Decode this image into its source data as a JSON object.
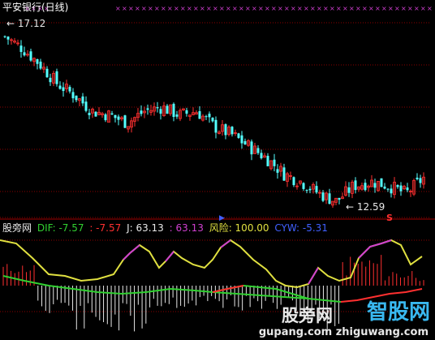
{
  "main_panel": {
    "title": "平安银行(日线)",
    "high_label": "17.12",
    "low_label": "12.59",
    "signal_marker": "S"
  },
  "indicator_panel": {
    "name": "股旁网",
    "items": [
      {
        "label": "DIF: -7.57",
        "color": "#30d030"
      },
      {
        "label": ": -7.57",
        "color": "#ff3030"
      },
      {
        "label": "J: 63.13",
        "color": "#e8e8e8"
      },
      {
        "label": ": 63.13",
        "color": "#d040d0"
      },
      {
        "label": "风险: 100.00",
        "color": "#e0e040"
      },
      {
        "label": "CYW: -5.31",
        "color": "#4060ff"
      }
    ]
  },
  "watermark": {
    "text1": "股旁网",
    "text2": "智股网",
    "url": "gupang.com  zhiguwang.com"
  },
  "colors": {
    "up": "#ff3030",
    "down": "#54ffff",
    "dif": "#30d030",
    "dea": "#ff3030",
    "j": "#e0e040",
    "j_high": "#d040d0",
    "marker": "#d040d0",
    "grid": "#8b0000"
  },
  "chart_data": [
    {
      "type": "candlestick",
      "title": "平安银行(日线)",
      "annotations": [
        {
          "text": "17.12",
          "kind": "high"
        },
        {
          "text": "12.59",
          "kind": "low"
        }
      ],
      "close_trend": [
        16.9,
        16.6,
        16.2,
        15.7,
        15.4,
        15.0,
        14.9,
        14.7,
        15.0,
        15.1,
        14.9,
        15.0,
        14.6,
        14.4,
        14.1,
        13.8,
        13.4,
        13.2,
        12.9,
        12.7,
        13.1,
        13.2,
        13.1,
        12.9,
        13.3
      ]
    },
    {
      "type": "line",
      "series": [
        {
          "name": "DIF",
          "last": -7.57
        },
        {
          "name": "J",
          "last": 63.13
        },
        {
          "name": "风险",
          "last": 100.0
        },
        {
          "name": "CYW",
          "last": -5.31
        }
      ]
    }
  ]
}
